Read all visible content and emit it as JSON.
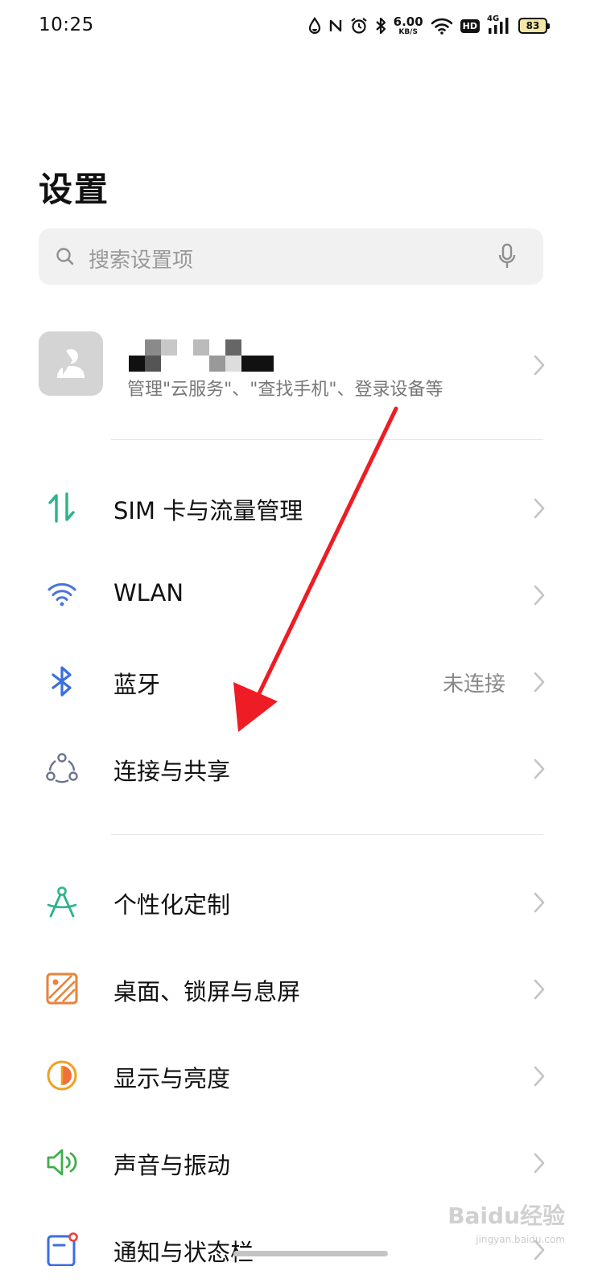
{
  "status_bar": {
    "time": "10:25",
    "net_speed_value": "6.00",
    "net_speed_unit": "KB/S",
    "hd_label": "HD",
    "network_type": "4G",
    "battery_level": "83",
    "icons": [
      "water-drop-icon",
      "nfc-icon",
      "alarm-icon",
      "bluetooth-icon",
      "wifi-icon",
      "signal-icon"
    ]
  },
  "header": {
    "title": "设置"
  },
  "search": {
    "placeholder": "搜索设置项"
  },
  "account": {
    "subtitle": "管理\"云服务\"、\"查找手机\"、登录设备等"
  },
  "settings": {
    "items": [
      {
        "label": "SIM 卡与流量管理",
        "icon": "sim-data-icon",
        "color": "#2bb38a"
      },
      {
        "label": "WLAN",
        "icon": "wifi-icon",
        "color": "#4a73d9"
      },
      {
        "label": "蓝牙",
        "value": "未连接",
        "icon": "bluetooth-icon",
        "color": "#3a6fe0"
      },
      {
        "label": "连接与共享",
        "icon": "connection-share-icon",
        "color": "#6b7390"
      },
      {
        "label": "个性化定制",
        "icon": "compass-icon",
        "color": "#2bb38a"
      },
      {
        "label": "桌面、锁屏与息屏",
        "icon": "wallpaper-icon",
        "color": "#e9823a"
      },
      {
        "label": "显示与亮度",
        "icon": "brightness-icon",
        "color": "#f0a020"
      },
      {
        "label": "声音与振动",
        "icon": "speaker-icon",
        "color": "#3fae4a"
      },
      {
        "label": "通知与状态栏",
        "icon": "notification-icon",
        "color": "#3a6fe0"
      }
    ]
  },
  "annotation": {
    "arrow_color": "#ee1c24"
  },
  "watermark": {
    "main": "Baidu经验",
    "sub": "jingyan.baidu.com"
  }
}
